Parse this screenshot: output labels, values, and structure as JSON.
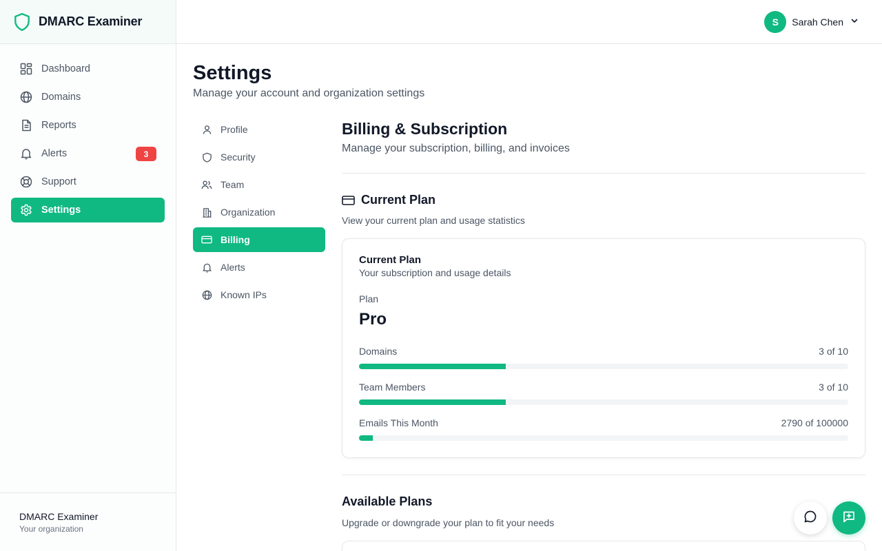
{
  "brand": {
    "name": "DMARC Examiner"
  },
  "sidebar": {
    "items": [
      {
        "label": "Dashboard",
        "icon": "dashboard-icon"
      },
      {
        "label": "Domains",
        "icon": "globe-icon"
      },
      {
        "label": "Reports",
        "icon": "file-icon"
      },
      {
        "label": "Alerts",
        "icon": "bell-icon",
        "badge": "3"
      },
      {
        "label": "Support",
        "icon": "lifebuoy-icon"
      },
      {
        "label": "Settings",
        "icon": "gear-icon",
        "active": true
      }
    ],
    "footer": {
      "org": "DMARC Examiner",
      "sub": "Your organization"
    }
  },
  "header": {
    "user": {
      "initial": "S",
      "name": "Sarah Chen"
    }
  },
  "page": {
    "title": "Settings",
    "subtitle": "Manage your account and organization settings"
  },
  "subnav": {
    "items": [
      {
        "label": "Profile",
        "icon": "user-icon"
      },
      {
        "label": "Security",
        "icon": "shield-icon"
      },
      {
        "label": "Team",
        "icon": "users-icon"
      },
      {
        "label": "Organization",
        "icon": "building-icon"
      },
      {
        "label": "Billing",
        "icon": "credit-card-icon",
        "active": true
      },
      {
        "label": "Alerts",
        "icon": "bell-icon"
      },
      {
        "label": "Known IPs",
        "icon": "globe-icon"
      }
    ]
  },
  "billing": {
    "title": "Billing & Subscription",
    "subtitle": "Manage your subscription, billing, and invoices",
    "current_plan": {
      "heading": "Current Plan",
      "description": "View your current plan and usage statistics",
      "card_title": "Current Plan",
      "card_subtitle": "Your subscription and usage details",
      "plan_label": "Plan",
      "plan_name": "Pro",
      "usage": [
        {
          "label": "Domains",
          "value": "3 of 10",
          "fraction": 0.3
        },
        {
          "label": "Team Members",
          "value": "3 of 10",
          "fraction": 0.3
        },
        {
          "label": "Emails This Month",
          "value": "2790 of 100000",
          "fraction": 0.0279
        }
      ]
    },
    "available_plans": {
      "heading": "Available Plans",
      "description": "Upgrade or downgrade your plan to fit your needs"
    }
  },
  "colors": {
    "accent": "#10b981",
    "badge": "#ef4444"
  }
}
